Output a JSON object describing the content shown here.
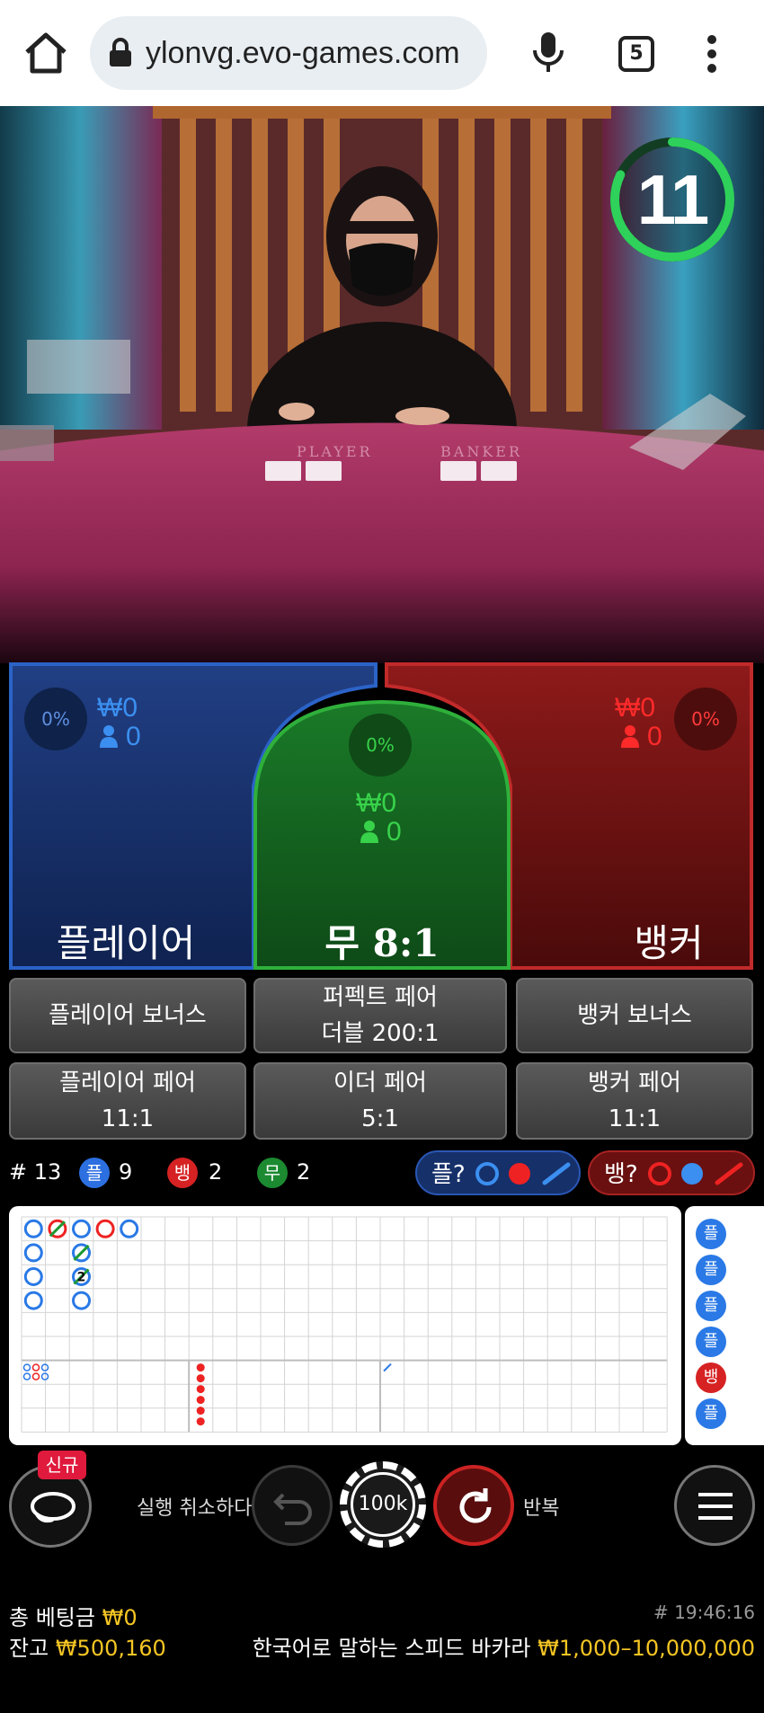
{
  "browser": {
    "url": "ylonvg.evo-games.com",
    "tab_count": "5",
    "icons": [
      "home-icon",
      "lock-icon",
      "microphone-icon",
      "tabs-icon",
      "more-vert-icon"
    ]
  },
  "video": {
    "timer": "11",
    "table_labels": {
      "player": "PLAYER",
      "banker": "BANKER"
    }
  },
  "bets": {
    "player": {
      "pct": "0%",
      "amount": "₩0",
      "count": "0",
      "label": "플레이어",
      "color": "#1e3b82"
    },
    "tie": {
      "pct": "0%",
      "amount": "₩0",
      "count": "0",
      "label": "무 8:1",
      "color": "#1a7d2a"
    },
    "banker": {
      "pct": "0%",
      "amount": "₩0",
      "count": "0",
      "label": "뱅커",
      "color": "#8c1515"
    }
  },
  "sidebets": {
    "player_bonus": "플레이어 보너스",
    "perfect_pair_line1": "퍼펙트 페어",
    "perfect_pair_line2": "더블 200:1",
    "banker_bonus": "뱅커 보너스",
    "player_pair_line1": "플레이어 페어",
    "player_pair_line2": "11:1",
    "either_pair_line1": "이더 페어",
    "either_pair_line2": "5:1",
    "banker_pair_line1": "뱅커 페어",
    "banker_pair_line2": "11:1"
  },
  "stats": {
    "round": "# 13",
    "player_label": "플",
    "player_count": "9",
    "banker_label": "뱅",
    "banker_count": "2",
    "tie_label": "무",
    "tie_count": "2",
    "player_predict": "플?",
    "banker_predict": "뱅?"
  },
  "road": {
    "big_road": [
      {
        "col": 0,
        "row": 0,
        "type": "P"
      },
      {
        "col": 0,
        "row": 1,
        "type": "P"
      },
      {
        "col": 0,
        "row": 2,
        "type": "P"
      },
      {
        "col": 0,
        "row": 3,
        "type": "P"
      },
      {
        "col": 1,
        "row": 0,
        "type": "B",
        "tie": true
      },
      {
        "col": 2,
        "row": 0,
        "type": "P"
      },
      {
        "col": 2,
        "row": 1,
        "type": "P",
        "tie": true
      },
      {
        "col": 2,
        "row": 2,
        "type": "P",
        "tie_count": "2"
      },
      {
        "col": 2,
        "row": 3,
        "type": "P"
      },
      {
        "col": 3,
        "row": 0,
        "type": "B"
      },
      {
        "col": 4,
        "row": 0,
        "type": "P"
      }
    ],
    "tie_mark_count": "2",
    "bead_column": [
      "플",
      "플",
      "플",
      "플",
      "뱅",
      "플"
    ]
  },
  "controls": {
    "new_badge": "신규",
    "undo_label": "실행 취소하다",
    "chip_value": "100k",
    "repeat_label": "반복"
  },
  "footer": {
    "total_bet_label": "총 베팅금",
    "total_bet_value": "₩0",
    "balance_label": "잔고",
    "balance_value": "₩500,160",
    "time": "# 19:46:16",
    "game_name": "한국어로 말하는 스피드 바카라",
    "limits": "₩1,000–10,000,000"
  }
}
